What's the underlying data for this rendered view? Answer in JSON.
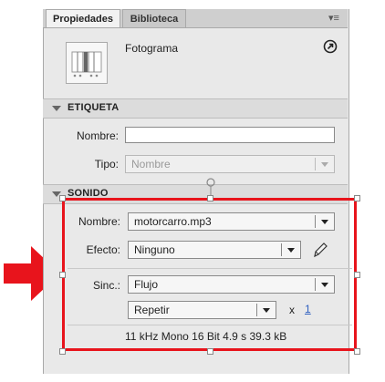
{
  "tabs": [
    {
      "label": "Propiedades",
      "active": true
    },
    {
      "label": "Biblioteca",
      "active": false
    }
  ],
  "panel_menu_icon": "panel-menu-icon",
  "header": {
    "title": "Fotograma",
    "edit_icon": "edit-in-place-icon"
  },
  "etiqueta": {
    "title": "ETIQUETA",
    "nombre_label": "Nombre:",
    "nombre_value": "",
    "tipo_label": "Tipo:",
    "tipo_value": "Nombre"
  },
  "sonido": {
    "title": "SONIDO",
    "nombre_label": "Nombre:",
    "nombre_value": "motorcarro.mp3",
    "efecto_label": "Efecto:",
    "efecto_value": "Ninguno",
    "sinc_label": "Sinc.:",
    "sinc_value": "Flujo",
    "repetir_value": "Repetir",
    "x_label": "x",
    "repeat_count": "1",
    "info": "11 kHz Mono 16 Bit 4.9 s 39.3 kB"
  },
  "colors": {
    "highlight": "#e8141c",
    "arrow": "#e8141c"
  }
}
